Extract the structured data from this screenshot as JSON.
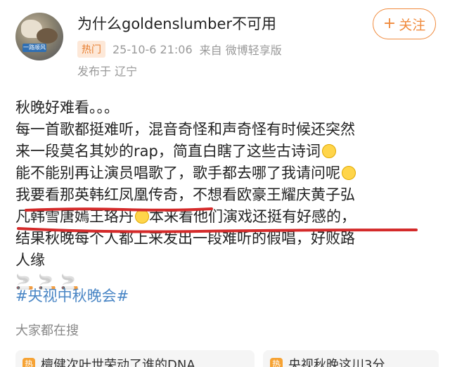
{
  "header": {
    "username": "为什么goldenslumber不可用",
    "badge": "热门",
    "timestamp": "25-10-6 21:06",
    "source": "来自 微博轻享版",
    "location": "发布于 辽宁",
    "avatar_tag": "一路顺风",
    "follow": {
      "plus": "+",
      "label": "关注"
    }
  },
  "post": {
    "lines": [
      "秋晚好难看。。。",
      "每一首歌都挺难听，混音奇怪和声奇怪有时候还突然",
      "来一段莫名其妙的rap，简直白瞎了这些古诗词",
      "能不能别再让演员唱歌了，歌手都去哪了我请问呢",
      "我要看那英韩红凤凰传奇，不想看欧豪王耀庆黄子弘",
      "凡韩雪唐嫣王珞丹",
      "本来看他们演戏还挺有好感的，",
      "结果秋晚每个人都上来发出一段难听的假唱，好败路",
      "人缘"
    ],
    "cigarettes": "🚬🚬🚬",
    "hashtag": "#央视中秋晚会#",
    "emoji_names": [
      "smile-emoji",
      "thinking-emoji",
      "awkward-emoji"
    ]
  },
  "search": {
    "title": "大家都在搜",
    "items": [
      {
        "icon": "热",
        "text": "檀健次叶世荣动了谁的DNA"
      },
      {
        "icon": "热",
        "text": "央视秋晚这川3分"
      }
    ]
  },
  "colors": {
    "accent": "#f08a3c",
    "hashtag": "#4a86c5",
    "underline": "#d42a2a"
  }
}
